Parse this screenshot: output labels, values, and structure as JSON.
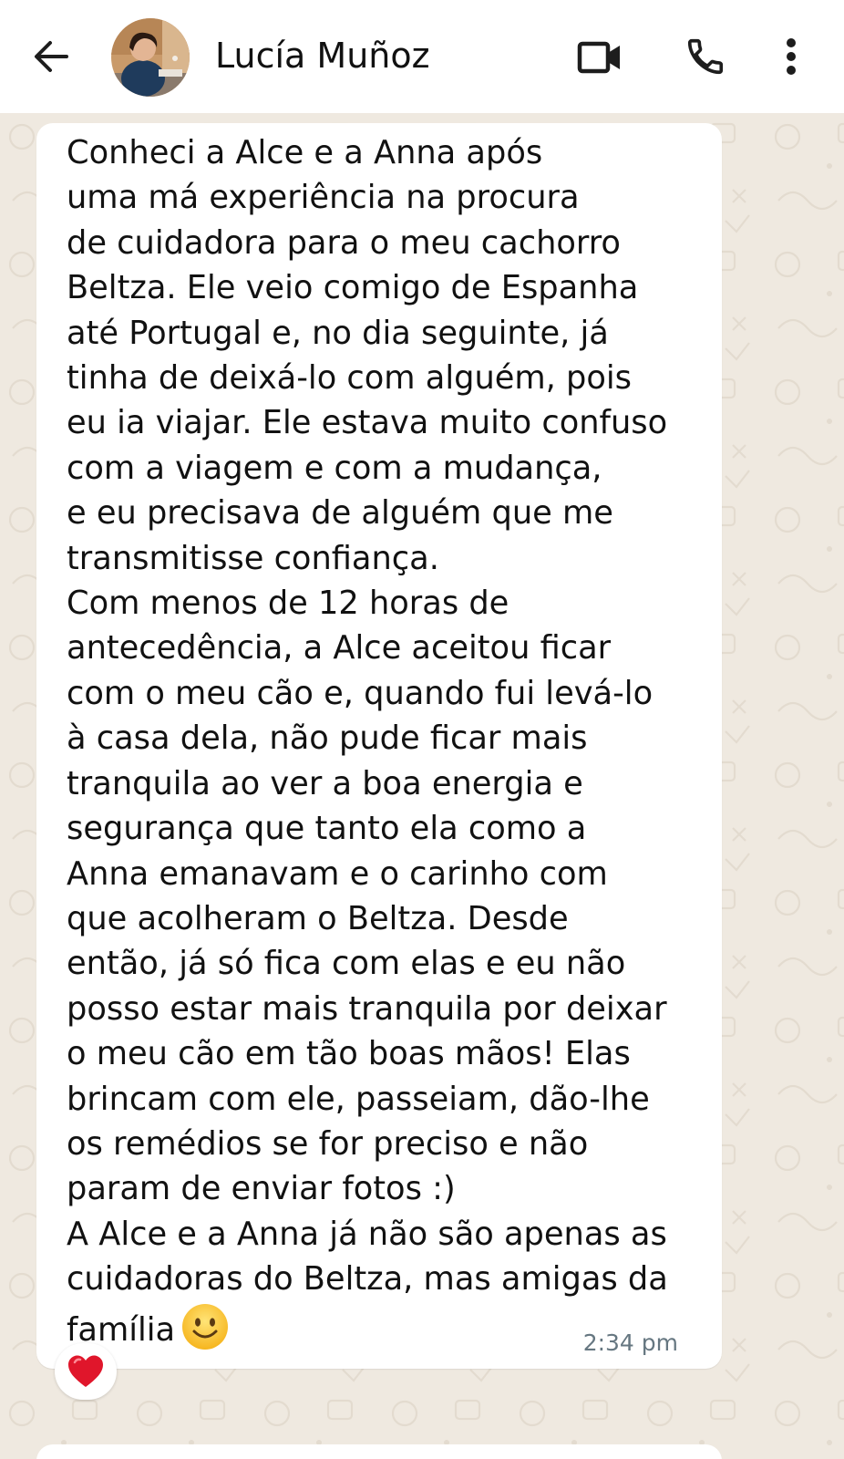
{
  "header": {
    "contact_name": "Lucía Muñoz",
    "back_icon": "arrow-left-icon",
    "video_icon": "video-camera-icon",
    "call_icon": "phone-icon",
    "menu_icon": "more-vertical-icon"
  },
  "message": {
    "text": "Conheci a Alce e a Anna após\numa má experiência na procura\nde cuidadora para o meu cachorro\nBeltza. Ele veio comigo de Espanha\naté Portugal e, no dia seguinte, já\ntinha de deixá-lo com alguém, pois\neu ia viajar. Ele estava muito confuso\ncom a viagem e com a mudança,\ne eu precisava de alguém que me\ntransmitisse confiança.\nCom menos de 12 horas de\nantecedência, a Alce aceitou ficar\ncom o meu cão e, quando fui levá-lo\nà casa dela, não pude ficar mais\ntranquila ao ver a boa energia e\nsegurança que tanto ela como a\nAnna emanavam e o carinho com\nque acolheram o Beltza. Desde\nentão, já só fica com elas e eu não\nposso estar mais tranquila por deixar\no meu cão em tão boas mãos! Elas\nbrincam com ele, passeiam, dão-lhe\nos remédios se for preciso e não\nparam de enviar fotos :)\nA Alce e a Anna já não são apenas as\ncuidadoras do Beltza, mas amigas da\nfamília",
    "emoji": "smiling-face-emoji",
    "time": "2:34 pm",
    "reaction": "red-heart-emoji"
  },
  "colors": {
    "header_bg": "#ffffff",
    "chat_bg": "#efe9e0",
    "bubble_bg": "#ffffff",
    "text": "#111111",
    "timestamp": "#667781",
    "heart": "#e0162b"
  }
}
